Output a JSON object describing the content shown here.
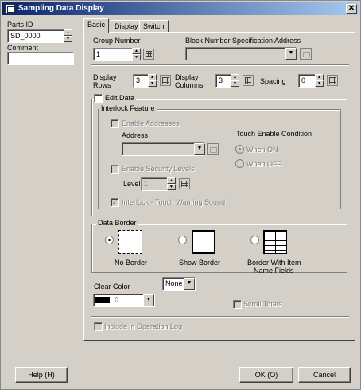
{
  "window": {
    "title": "Sampling Data Display",
    "close_label": "✕"
  },
  "left": {
    "parts_id_label": "Parts ID",
    "parts_id_value": "SD_0000",
    "comment_label": "Comment",
    "comment_value": ""
  },
  "tabs": [
    {
      "label": "Basic"
    },
    {
      "label": "Display"
    },
    {
      "label": "Switch"
    }
  ],
  "basic": {
    "group_number_label": "Group Number",
    "group_number_value": "1",
    "block_number_label": "Block Number Specification Address",
    "block_number_value": "",
    "display_rows_label_1": "Display",
    "display_rows_label_2": "Rows",
    "display_rows_value": "3",
    "display_columns_label_1": "Display",
    "display_columns_label_2": "Columns",
    "display_columns_value": "3",
    "spacing_label": "Spacing",
    "spacing_value": "0",
    "edit_data_label": "Edit Data",
    "interlock": {
      "title": "Interlock Feature",
      "enable_addresses_label": "Enable Addresses",
      "address_label": "Address",
      "address_value": "",
      "touch_enable_label": "Touch Enable Condition",
      "when_on_label": "When ON",
      "when_off_label": "When OFF",
      "enable_security_label": "Enable Security Levels",
      "level_label": "Level",
      "level_value": "1",
      "warning_sound_label": "Interlock - Touch Warning Sound"
    },
    "data_border": {
      "title": "Data Border",
      "no_border_label": "No Border",
      "show_border_label": "Show Border",
      "item_name_label_1": "Border With Item",
      "item_name_label_2": "Name Fields"
    },
    "clear_color_label": "Clear Color",
    "clear_color_value": "0",
    "clear_color_swatch": "#000000",
    "none_value": "None",
    "scroll_totals_label": "Scroll Totals",
    "include_log_label": "Include in Operation Log"
  },
  "buttons": {
    "help": "Help (H)",
    "ok": "OK (O)",
    "cancel": "Cancel"
  }
}
